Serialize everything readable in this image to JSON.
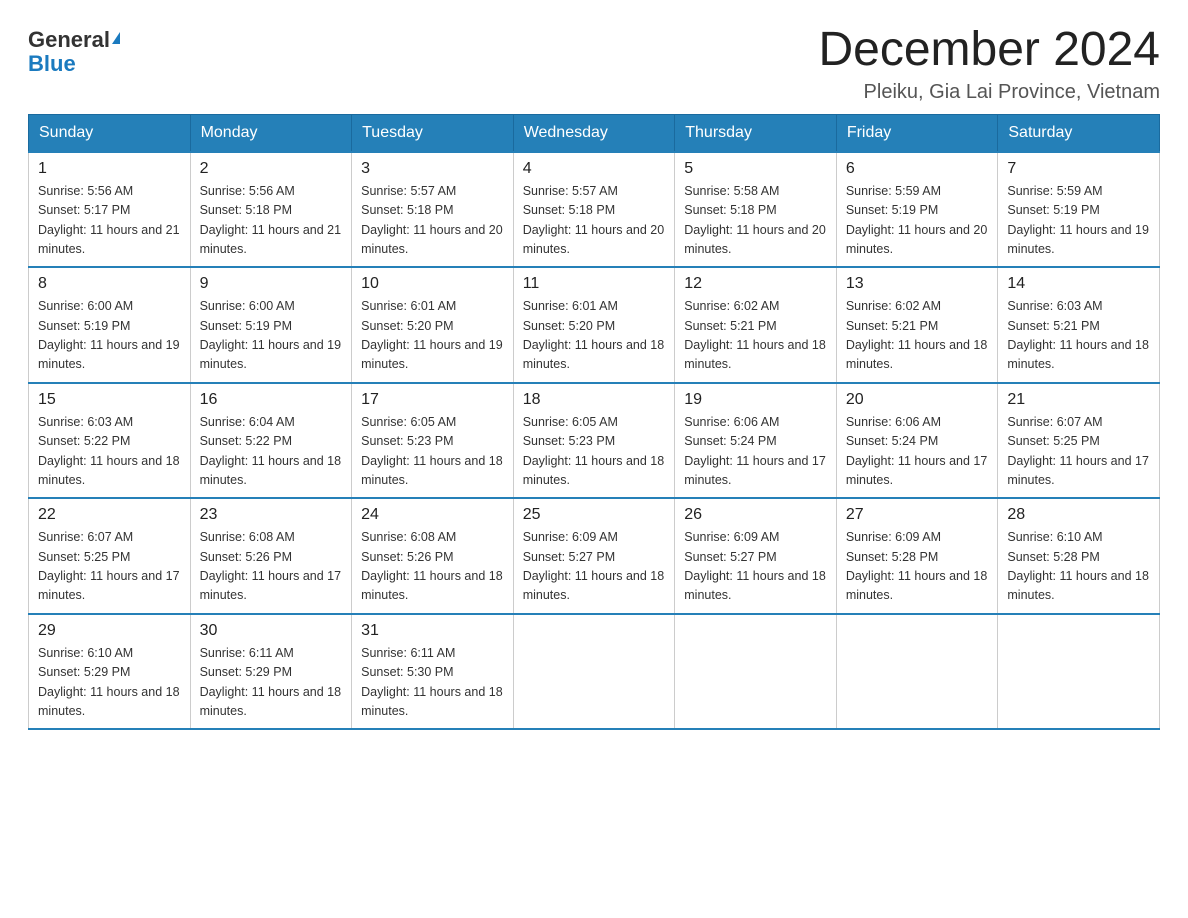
{
  "logo": {
    "general": "General",
    "blue": "Blue"
  },
  "header": {
    "title": "December 2024",
    "location": "Pleiku, Gia Lai Province, Vietnam"
  },
  "weekdays": [
    "Sunday",
    "Monday",
    "Tuesday",
    "Wednesday",
    "Thursday",
    "Friday",
    "Saturday"
  ],
  "weeks": [
    [
      {
        "day": "1",
        "sunrise": "5:56 AM",
        "sunset": "5:17 PM",
        "daylight": "11 hours and 21 minutes."
      },
      {
        "day": "2",
        "sunrise": "5:56 AM",
        "sunset": "5:18 PM",
        "daylight": "11 hours and 21 minutes."
      },
      {
        "day": "3",
        "sunrise": "5:57 AM",
        "sunset": "5:18 PM",
        "daylight": "11 hours and 20 minutes."
      },
      {
        "day": "4",
        "sunrise": "5:57 AM",
        "sunset": "5:18 PM",
        "daylight": "11 hours and 20 minutes."
      },
      {
        "day": "5",
        "sunrise": "5:58 AM",
        "sunset": "5:18 PM",
        "daylight": "11 hours and 20 minutes."
      },
      {
        "day": "6",
        "sunrise": "5:59 AM",
        "sunset": "5:19 PM",
        "daylight": "11 hours and 20 minutes."
      },
      {
        "day": "7",
        "sunrise": "5:59 AM",
        "sunset": "5:19 PM",
        "daylight": "11 hours and 19 minutes."
      }
    ],
    [
      {
        "day": "8",
        "sunrise": "6:00 AM",
        "sunset": "5:19 PM",
        "daylight": "11 hours and 19 minutes."
      },
      {
        "day": "9",
        "sunrise": "6:00 AM",
        "sunset": "5:19 PM",
        "daylight": "11 hours and 19 minutes."
      },
      {
        "day": "10",
        "sunrise": "6:01 AM",
        "sunset": "5:20 PM",
        "daylight": "11 hours and 19 minutes."
      },
      {
        "day": "11",
        "sunrise": "6:01 AM",
        "sunset": "5:20 PM",
        "daylight": "11 hours and 18 minutes."
      },
      {
        "day": "12",
        "sunrise": "6:02 AM",
        "sunset": "5:21 PM",
        "daylight": "11 hours and 18 minutes."
      },
      {
        "day": "13",
        "sunrise": "6:02 AM",
        "sunset": "5:21 PM",
        "daylight": "11 hours and 18 minutes."
      },
      {
        "day": "14",
        "sunrise": "6:03 AM",
        "sunset": "5:21 PM",
        "daylight": "11 hours and 18 minutes."
      }
    ],
    [
      {
        "day": "15",
        "sunrise": "6:03 AM",
        "sunset": "5:22 PM",
        "daylight": "11 hours and 18 minutes."
      },
      {
        "day": "16",
        "sunrise": "6:04 AM",
        "sunset": "5:22 PM",
        "daylight": "11 hours and 18 minutes."
      },
      {
        "day": "17",
        "sunrise": "6:05 AM",
        "sunset": "5:23 PM",
        "daylight": "11 hours and 18 minutes."
      },
      {
        "day": "18",
        "sunrise": "6:05 AM",
        "sunset": "5:23 PM",
        "daylight": "11 hours and 18 minutes."
      },
      {
        "day": "19",
        "sunrise": "6:06 AM",
        "sunset": "5:24 PM",
        "daylight": "11 hours and 17 minutes."
      },
      {
        "day": "20",
        "sunrise": "6:06 AM",
        "sunset": "5:24 PM",
        "daylight": "11 hours and 17 minutes."
      },
      {
        "day": "21",
        "sunrise": "6:07 AM",
        "sunset": "5:25 PM",
        "daylight": "11 hours and 17 minutes."
      }
    ],
    [
      {
        "day": "22",
        "sunrise": "6:07 AM",
        "sunset": "5:25 PM",
        "daylight": "11 hours and 17 minutes."
      },
      {
        "day": "23",
        "sunrise": "6:08 AM",
        "sunset": "5:26 PM",
        "daylight": "11 hours and 17 minutes."
      },
      {
        "day": "24",
        "sunrise": "6:08 AM",
        "sunset": "5:26 PM",
        "daylight": "11 hours and 18 minutes."
      },
      {
        "day": "25",
        "sunrise": "6:09 AM",
        "sunset": "5:27 PM",
        "daylight": "11 hours and 18 minutes."
      },
      {
        "day": "26",
        "sunrise": "6:09 AM",
        "sunset": "5:27 PM",
        "daylight": "11 hours and 18 minutes."
      },
      {
        "day": "27",
        "sunrise": "6:09 AM",
        "sunset": "5:28 PM",
        "daylight": "11 hours and 18 minutes."
      },
      {
        "day": "28",
        "sunrise": "6:10 AM",
        "sunset": "5:28 PM",
        "daylight": "11 hours and 18 minutes."
      }
    ],
    [
      {
        "day": "29",
        "sunrise": "6:10 AM",
        "sunset": "5:29 PM",
        "daylight": "11 hours and 18 minutes."
      },
      {
        "day": "30",
        "sunrise": "6:11 AM",
        "sunset": "5:29 PM",
        "daylight": "11 hours and 18 minutes."
      },
      {
        "day": "31",
        "sunrise": "6:11 AM",
        "sunset": "5:30 PM",
        "daylight": "11 hours and 18 minutes."
      },
      null,
      null,
      null,
      null
    ]
  ],
  "labels": {
    "sunrise": "Sunrise:",
    "sunset": "Sunset:",
    "daylight": "Daylight:"
  }
}
